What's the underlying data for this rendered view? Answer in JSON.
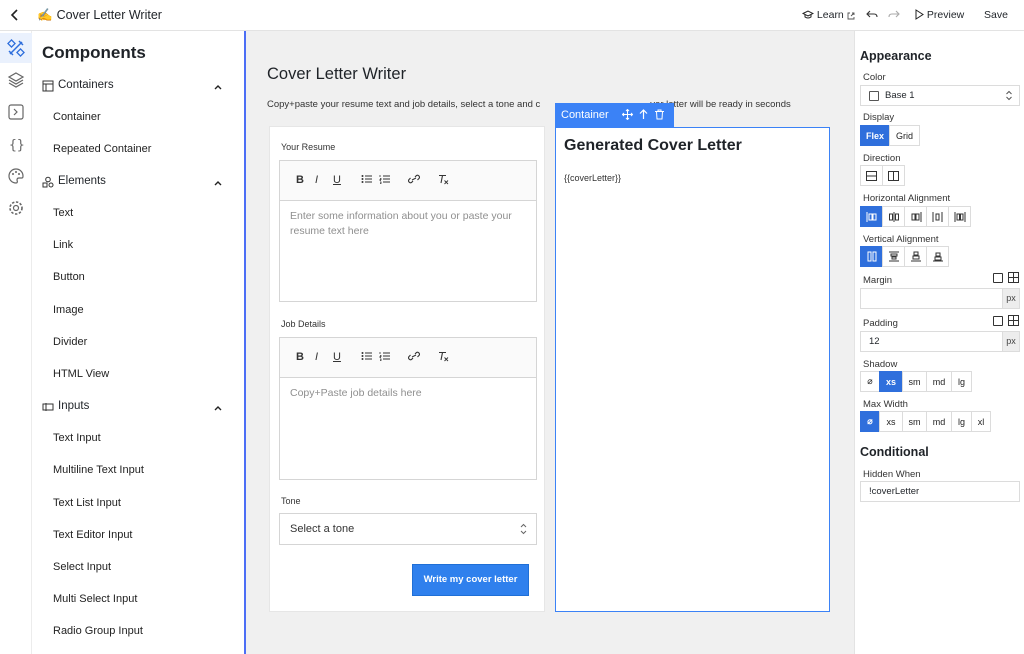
{
  "topbar": {
    "title_emoji": "✍️",
    "title": "Cover Letter Writer",
    "learn": "Learn",
    "preview": "Preview",
    "save": "Save"
  },
  "components": {
    "title": "Components",
    "groups": [
      {
        "label": "Containers",
        "items": [
          "Container",
          "Repeated Container"
        ]
      },
      {
        "label": "Elements",
        "items": [
          "Text",
          "Link",
          "Button",
          "Image",
          "Divider",
          "HTML View"
        ]
      },
      {
        "label": "Inputs",
        "items": [
          "Text Input",
          "Multiline Text Input",
          "Text List Input",
          "Text Editor Input",
          "Select Input",
          "Multi Select Input",
          "Radio Group Input"
        ]
      }
    ]
  },
  "canvas": {
    "title": "Cover Letter Writer",
    "subtitle_left": "Copy+paste your resume text and job details, select a tone and c",
    "subtitle_right": "ver letter will be ready in seconds",
    "resume_label": "Your Resume",
    "resume_placeholder": "Enter some information about you or paste your resume text here",
    "job_label": "Job Details",
    "job_placeholder": "Copy+Paste job details here",
    "tone_label": "Tone",
    "tone_value": "Select a tone",
    "submit_label": "Write my cover letter",
    "container_tag": "Container",
    "output_title": "Generated Cover Letter",
    "output_var": "{{coverLetter}}"
  },
  "props": {
    "appearance": "Appearance",
    "color_label": "Color",
    "color_value": "Base 1",
    "display_label": "Display",
    "display_options": [
      "Flex",
      "Grid"
    ],
    "display_selected": "Flex",
    "direction_label": "Direction",
    "h_align_label": "Horizontal Alignment",
    "v_align_label": "Vertical Alignment",
    "margin_label": "Margin",
    "margin_value": "",
    "padding_label": "Padding",
    "padding_value": "12",
    "unit": "px",
    "shadow_label": "Shadow",
    "shadow_options": [
      "⌀",
      "xs",
      "sm",
      "md",
      "lg"
    ],
    "shadow_selected": "xs",
    "maxwidth_label": "Max Width",
    "maxwidth_options": [
      "⌀",
      "xs",
      "sm",
      "md",
      "lg",
      "xl"
    ],
    "maxwidth_selected": "⌀",
    "conditional": "Conditional",
    "hidden_label": "Hidden When",
    "hidden_value": "!coverLetter"
  },
  "colors": {
    "accent": "#2f6fdc",
    "selection": "#3b82f6",
    "button": "#2f80ed"
  },
  "icons": [
    "back-icon",
    "learn-cap-icon",
    "undo-icon",
    "redo-icon",
    "play-icon",
    "build-icon",
    "layers-icon",
    "code-icon",
    "braces-icon",
    "palette-icon",
    "settings-icon"
  ]
}
